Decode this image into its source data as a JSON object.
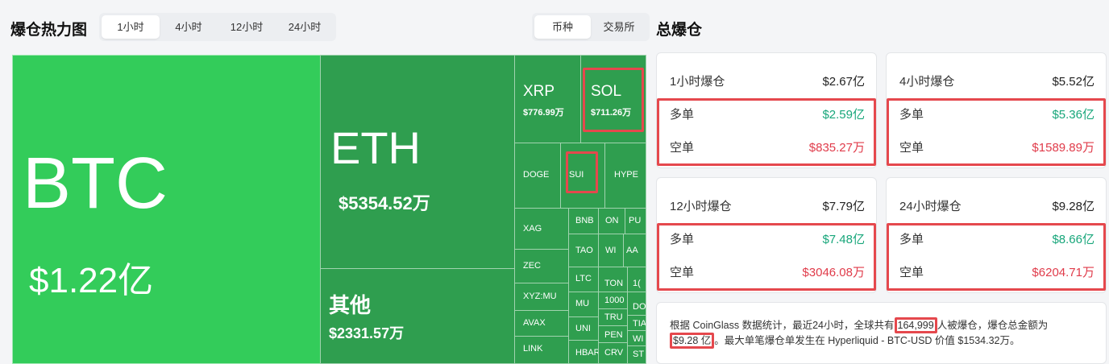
{
  "header": {
    "heatmap_title": "爆仓热力图",
    "time_tabs": [
      "1小时",
      "4小时",
      "12小时",
      "24小时"
    ],
    "group_tabs": [
      "币种",
      "交易所"
    ],
    "total_title": "总爆仓"
  },
  "treemap": {
    "btc": {
      "sym": "BTC",
      "val": "$1.22亿"
    },
    "eth": {
      "sym": "ETH",
      "val": "$5354.52万"
    },
    "other": {
      "sym": "其他",
      "val": "$2331.57万"
    },
    "xrp": {
      "sym": "XRP",
      "val": "$776.99万"
    },
    "sol": {
      "sym": "SOL",
      "val": "$711.26万"
    },
    "doge": "DOGE",
    "sui": "SUI",
    "hype": "HYPE",
    "xag": "XAG",
    "zec": "ZEC",
    "xyz_mu": "XYZ:MU",
    "avax": "AVAX",
    "link": "LINK",
    "bnb": "BNB",
    "on": "ON",
    "pu": "PU",
    "tao": "TAO",
    "wi": "WI",
    "aa": "AA",
    "ltc": "LTC",
    "ton": "TON",
    "one": "1(",
    "mu": "MU",
    "k1000": "1000",
    "do": "DO",
    "uni": "UNI",
    "tru": "TRU",
    "ti": "TIA",
    "pen": "PEN",
    "wl": "WI",
    "hbar": "HBAR",
    "crv": "CRV",
    "st": "ST"
  },
  "cards": [
    {
      "title": "1小时爆仓",
      "total": "$2.67亿",
      "long_label": "多单",
      "long": "$2.59亿",
      "short_label": "空单",
      "short": "$835.27万"
    },
    {
      "title": "4小时爆仓",
      "total": "$5.52亿",
      "long_label": "多单",
      "long": "$5.36亿",
      "short_label": "空单",
      "short": "$1589.89万"
    },
    {
      "title": "12小时爆仓",
      "total": "$7.79亿",
      "long_label": "多单",
      "long": "$7.48亿",
      "short_label": "空单",
      "short": "$3046.08万"
    },
    {
      "title": "24小时爆仓",
      "total": "$9.28亿",
      "long_label": "多单",
      "long": "$8.66亿",
      "short_label": "空单",
      "short": "$6204.71万"
    }
  ],
  "summary": {
    "p1": "根据 CoinGlass 数据统计，最近24小时，全球共有",
    "count": "164,999",
    "p2": "人被爆仓，爆仓总金额为",
    "amount": "$9.28 亿",
    "p3": "。最大单笔爆仓单发生在 Hyperliquid - BTC-USD 价值 $1534.32万。"
  },
  "colors": {
    "green_bright": "#33cc5a",
    "green_mid": "#2f9e4f",
    "highlight_red": "#e5484d"
  }
}
